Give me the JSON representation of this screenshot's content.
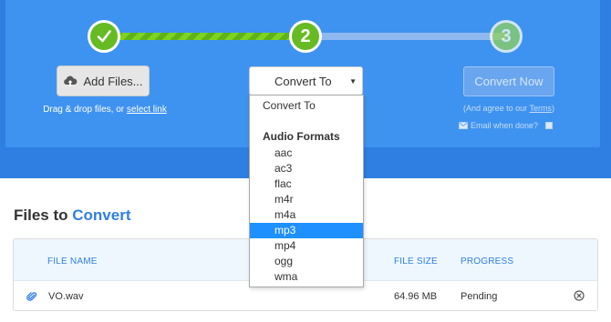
{
  "steps": [
    "1",
    "2",
    "3"
  ],
  "colors": {
    "brand_blue": "#2f7fe3",
    "panel_blue": "#3f93f0",
    "step_green": "#66bb22",
    "highlight": "#1e90ff"
  },
  "upload": {
    "add_files_label": "Add Files...",
    "drag_text": "Drag & drop files, or",
    "select_link": "select link"
  },
  "convert_select": {
    "value": "Convert To",
    "options_header": "Convert To",
    "group_label": "Audio Formats",
    "options": [
      "aac",
      "ac3",
      "flac",
      "m4r",
      "m4a",
      "mp3",
      "mp4",
      "ogg",
      "wma"
    ],
    "selected_index": 5
  },
  "convert_now": {
    "label": "Convert Now",
    "agree_text": "(And agree to our",
    "terms_link": "Terms",
    "agree_close": ")",
    "email_label": "Email when done?"
  },
  "files": {
    "title_part1": "Files to",
    "title_part2": "Convert",
    "columns": {
      "name": "FILE NAME",
      "size": "FILE SIZE",
      "progress": "PROGRESS"
    },
    "rows": [
      {
        "name": "VO.wav",
        "size": "64.96 MB",
        "progress": "Pending"
      }
    ]
  },
  "icons": [
    "check-icon",
    "upload-cloud-icon",
    "caret-down-icon",
    "mail-icon",
    "paperclip-icon",
    "remove-icon"
  ]
}
